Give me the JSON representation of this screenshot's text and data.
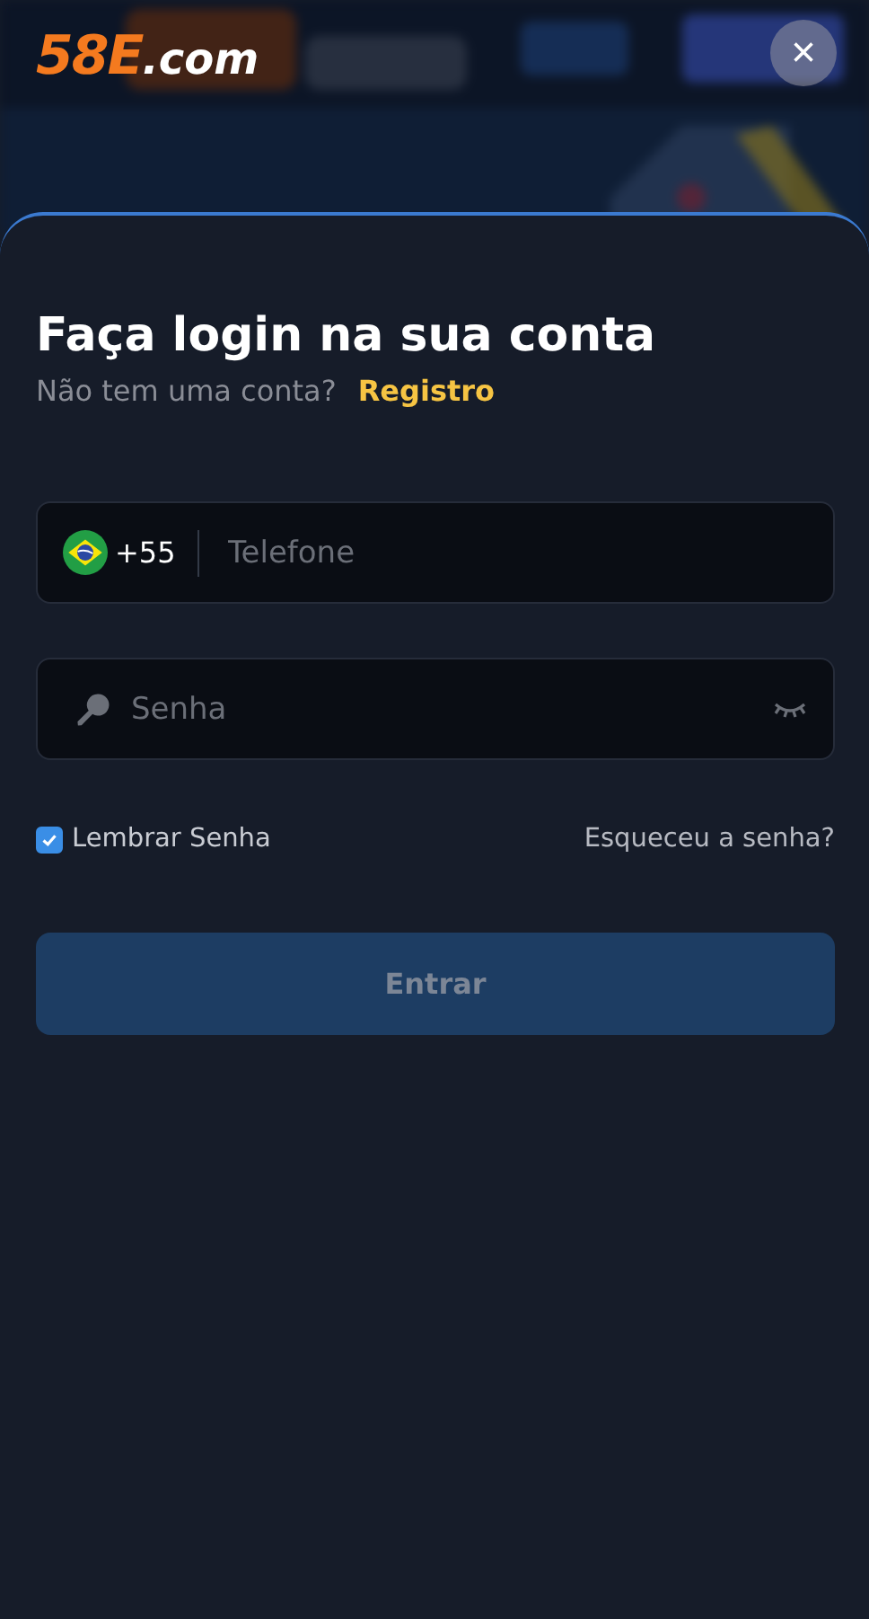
{
  "header": {
    "logo_main": "58E",
    "logo_suffix": ".com",
    "close": "×"
  },
  "login": {
    "title": "Faça login na sua conta",
    "prompt": "Não tem uma conta?",
    "register_link": "Registro",
    "phone": {
      "country_code": "+55",
      "placeholder": "Telefone"
    },
    "password": {
      "placeholder": "Senha"
    },
    "remember": {
      "label": "Lembrar Senha",
      "checked": true
    },
    "forgot_link": "Esqueceu a senha?",
    "submit": {
      "label": "Entrar",
      "disabled": true
    }
  }
}
